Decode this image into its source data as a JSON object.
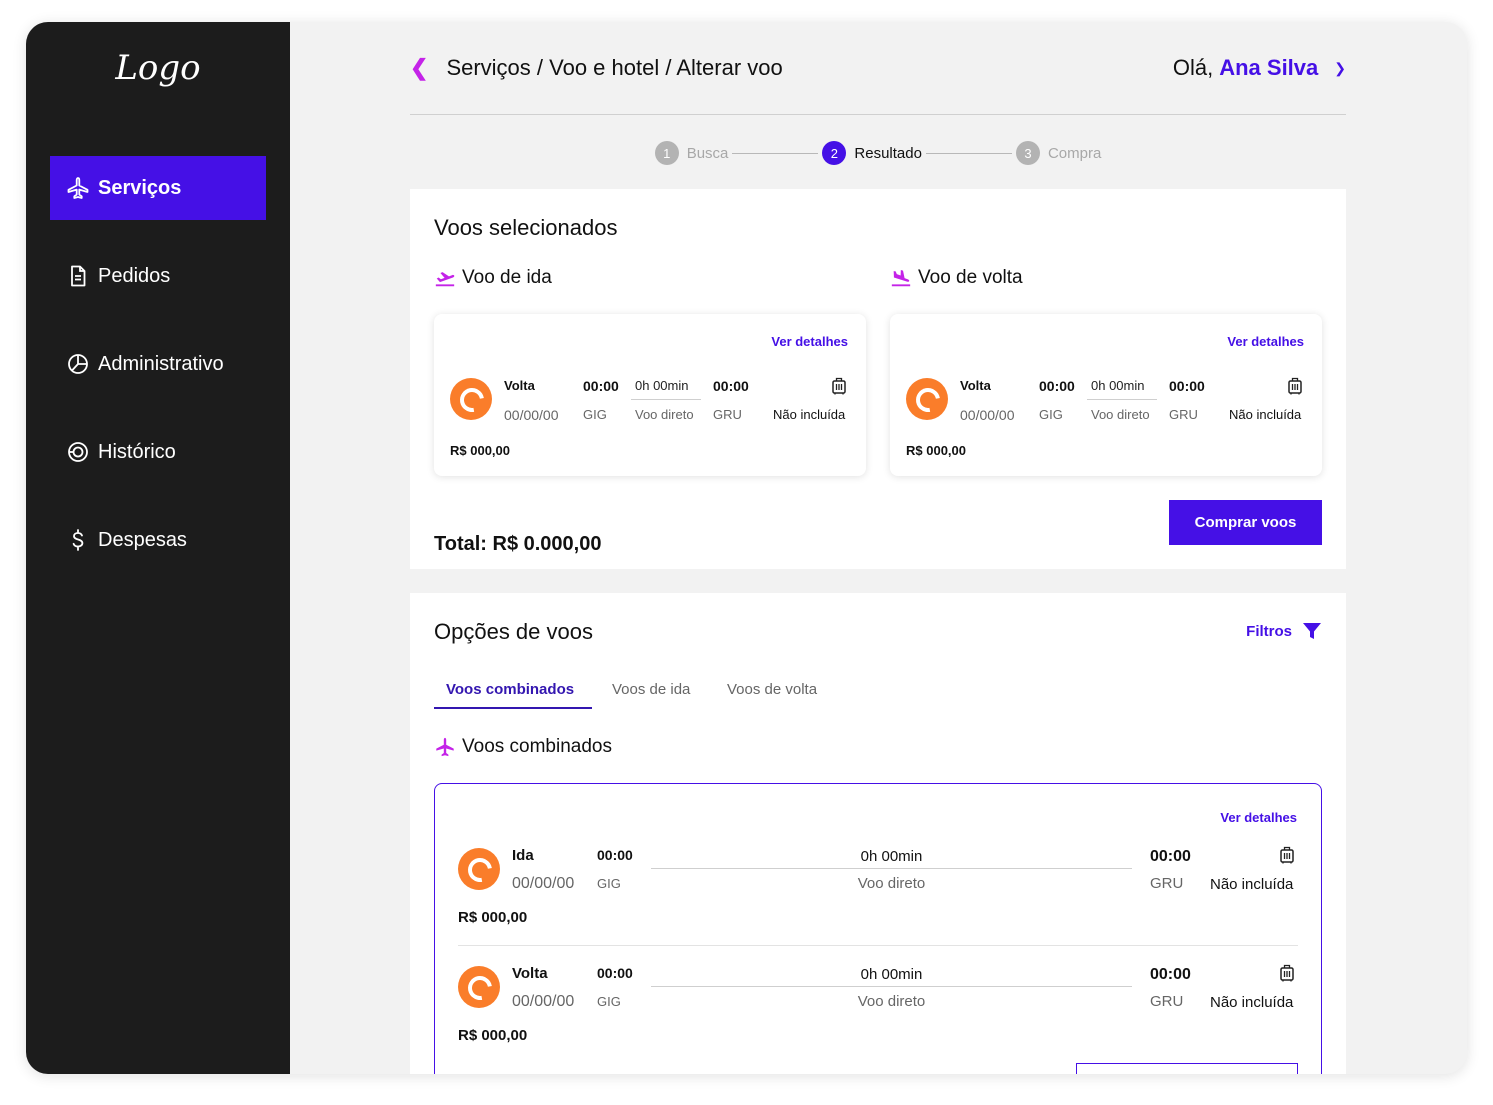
{
  "sidebar": {
    "logo": "Logo",
    "items": [
      {
        "label": "Serviços",
        "icon": "airplane-icon"
      },
      {
        "label": "Pedidos",
        "icon": "document-icon"
      },
      {
        "label": "Administrativo",
        "icon": "pie-chart-icon"
      },
      {
        "label": "Histórico",
        "icon": "history-icon"
      },
      {
        "label": "Despesas",
        "icon": "dollar-icon"
      }
    ]
  },
  "header": {
    "breadcrumb": "Serviços / Voo e hotel / Alterar voo",
    "greeting": "Olá,",
    "user_name": "Ana Silva"
  },
  "stepper": [
    {
      "num": "1",
      "label": "Busca"
    },
    {
      "num": "2",
      "label": "Resultado"
    },
    {
      "num": "3",
      "label": "Compra"
    }
  ],
  "selected": {
    "title": "Voos selecionados",
    "outbound_title": "Voo de ida",
    "return_title": "Voo de volta",
    "details_label": "Ver detalhes",
    "cards": [
      {
        "leg": "Volta",
        "date": "00/00/00",
        "dep_time": "00:00",
        "dep_airport": "GIG",
        "duration": "0h 00min",
        "type": "Voo direto",
        "arr_time": "00:00",
        "arr_airport": "GRU",
        "baggage": "Não incluída",
        "price": "R$ 000,00"
      },
      {
        "leg": "Volta",
        "date": "00/00/00",
        "dep_time": "00:00",
        "dep_airport": "GIG",
        "duration": "0h 00min",
        "type": "Voo direto",
        "arr_time": "00:00",
        "arr_airport": "GRU",
        "baggage": "Não incluída",
        "price": "R$ 000,00"
      }
    ],
    "total": "Total: R$ 0.000,00",
    "buy_label": "Comprar voos"
  },
  "options": {
    "title": "Opções de voos",
    "filters_label": "Filtros",
    "tabs": [
      "Voos combinados",
      "Voos de ida",
      "Voos de volta"
    ],
    "section_title": "Voos combinados",
    "details_label": "Ver detalhes",
    "rows": [
      {
        "leg": "Ida",
        "date": "00/00/00",
        "dep_time": "00:00",
        "dep_airport": "GIG",
        "duration": "0h 00min",
        "type": "Voo direto",
        "arr_time": "00:00",
        "arr_airport": "GRU",
        "baggage": "Não incluída",
        "price": "R$ 000,00"
      },
      {
        "leg": "Volta",
        "date": "00/00/00",
        "dep_time": "00:00",
        "dep_airport": "GIG",
        "duration": "0h 00min",
        "type": "Voo direto",
        "arr_time": "00:00",
        "arr_airport": "GRU",
        "baggage": "Não incluída",
        "price": "R$ 000,00"
      }
    ]
  },
  "colors": {
    "accent": "#4510e6",
    "magenta": "#c423e8",
    "airline": "#fa7d2a",
    "sidebar": "#1c1c1c"
  }
}
